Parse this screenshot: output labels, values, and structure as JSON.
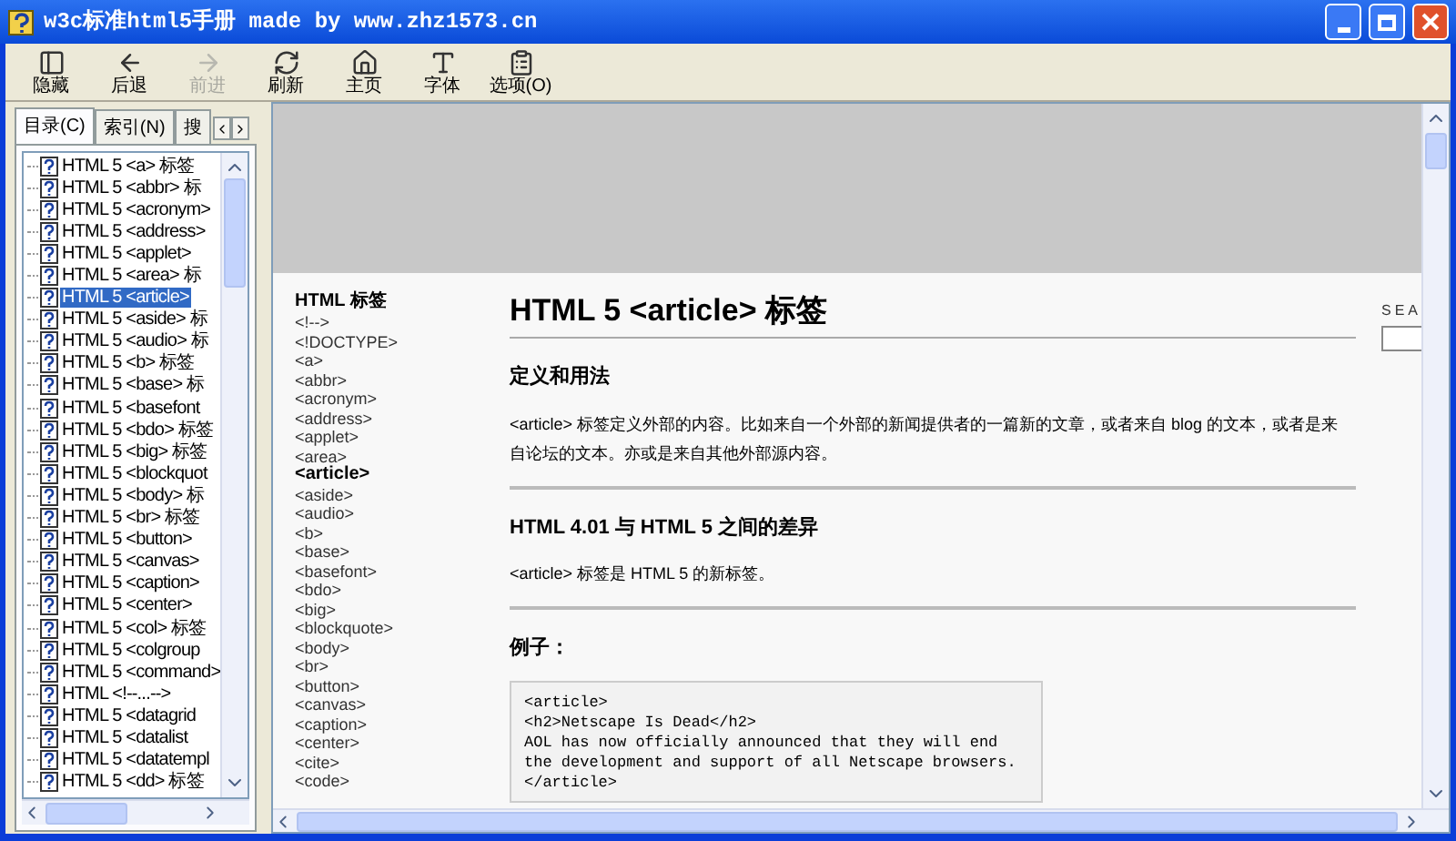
{
  "window": {
    "title": "w3c标准html5手册 made by www.zhz1573.cn"
  },
  "toolbar": [
    {
      "label": "隐藏",
      "disabled": false
    },
    {
      "label": "后退",
      "disabled": false
    },
    {
      "label": "前进",
      "disabled": true
    },
    {
      "label": "刷新",
      "disabled": false
    },
    {
      "label": "主页",
      "disabled": false
    },
    {
      "label": "字体",
      "disabled": false
    },
    {
      "label": "选项(O)",
      "disabled": false
    }
  ],
  "tabs": [
    {
      "label": "目录(C)",
      "selected": true
    },
    {
      "label": "索引(N)",
      "selected": false
    },
    {
      "label": "搜",
      "selected": false
    }
  ],
  "tree": {
    "items": [
      {
        "label": "HTML 5 <a> 标签",
        "selected": false
      },
      {
        "label": "HTML 5 <abbr> 标",
        "selected": false
      },
      {
        "label": "HTML 5 <acronym>",
        "selected": false
      },
      {
        "label": "HTML 5 <address>",
        "selected": false
      },
      {
        "label": "HTML 5 <applet>",
        "selected": false
      },
      {
        "label": "HTML 5 <area> 标",
        "selected": false
      },
      {
        "label": "HTML 5 <article>",
        "selected": true
      },
      {
        "label": "HTML 5 <aside> 标",
        "selected": false
      },
      {
        "label": "HTML 5 <audio> 标",
        "selected": false
      },
      {
        "label": "HTML 5 <b> 标签",
        "selected": false
      },
      {
        "label": "HTML 5 <base> 标",
        "selected": false
      },
      {
        "label": "HTML 5 <basefont",
        "selected": false
      },
      {
        "label": "HTML 5 <bdo> 标签",
        "selected": false
      },
      {
        "label": "HTML 5 <big> 标签",
        "selected": false
      },
      {
        "label": "HTML 5 <blockquot",
        "selected": false
      },
      {
        "label": "HTML 5 <body> 标",
        "selected": false
      },
      {
        "label": "HTML 5 <br> 标签",
        "selected": false
      },
      {
        "label": "HTML 5 <button>",
        "selected": false
      },
      {
        "label": "HTML 5 <canvas>",
        "selected": false
      },
      {
        "label": "HTML 5 <caption>",
        "selected": false
      },
      {
        "label": "HTML 5 <center>",
        "selected": false
      },
      {
        "label": "HTML 5 <col> 标签",
        "selected": false
      },
      {
        "label": "HTML 5 <colgroup",
        "selected": false
      },
      {
        "label": "HTML 5 <command>",
        "selected": false
      },
      {
        "label": "HTML <!--...-->",
        "selected": false
      },
      {
        "label": "HTML 5 <datagrid",
        "selected": false
      },
      {
        "label": "HTML 5 <datalist",
        "selected": false
      },
      {
        "label": "HTML 5 <datatempl",
        "selected": false
      },
      {
        "label": "HTML 5 <dd> 标签",
        "selected": false
      }
    ]
  },
  "page": {
    "nav": {
      "heading": "HTML 标签",
      "items": [
        {
          "label": "<!-->",
          "selected": false
        },
        {
          "label": "<!DOCTYPE>",
          "selected": false
        },
        {
          "label": "<a>",
          "selected": false
        },
        {
          "label": "<abbr>",
          "selected": false
        },
        {
          "label": "<acronym>",
          "selected": false
        },
        {
          "label": "<address>",
          "selected": false
        },
        {
          "label": "<applet>",
          "selected": false
        },
        {
          "label": "<area>",
          "selected": false
        },
        {
          "label": "<article>",
          "selected": true
        },
        {
          "label": "<aside>",
          "selected": false
        },
        {
          "label": "<audio>",
          "selected": false
        },
        {
          "label": "<b>",
          "selected": false
        },
        {
          "label": "<base>",
          "selected": false
        },
        {
          "label": "<basefont>",
          "selected": false
        },
        {
          "label": "<bdo>",
          "selected": false
        },
        {
          "label": "<big>",
          "selected": false
        },
        {
          "label": "<blockquote>",
          "selected": false
        },
        {
          "label": "<body>",
          "selected": false
        },
        {
          "label": "<br>",
          "selected": false
        },
        {
          "label": "<button>",
          "selected": false
        },
        {
          "label": "<canvas>",
          "selected": false
        },
        {
          "label": "<caption>",
          "selected": false
        },
        {
          "label": "<center>",
          "selected": false
        },
        {
          "label": "<cite>",
          "selected": false
        },
        {
          "label": "<code>",
          "selected": false
        }
      ]
    },
    "title": "HTML 5 <article> 标签",
    "sections": [
      {
        "heading": "定义和用法",
        "text": "<article> 标签定义外部的内容。比如来自一个外部的新闻提供者的一篇新的文章，或者来自 blog 的文本，或者是来自论坛的文本。亦或是来自其他外部源内容。"
      },
      {
        "heading": "HTML 4.01 与  HTML 5 之间的差异",
        "text": "<article> 标签是 HTML 5 的新标签。"
      },
      {
        "heading": "例子：",
        "code": [
          "<article>",
          "<h2>Netscape Is Dead</h2>",
          "AOL has now officially announced that they will end",
          "the development and support of all Netscape browsers.",
          "</article>"
        ]
      }
    ],
    "search": {
      "label": "SEA"
    }
  }
}
